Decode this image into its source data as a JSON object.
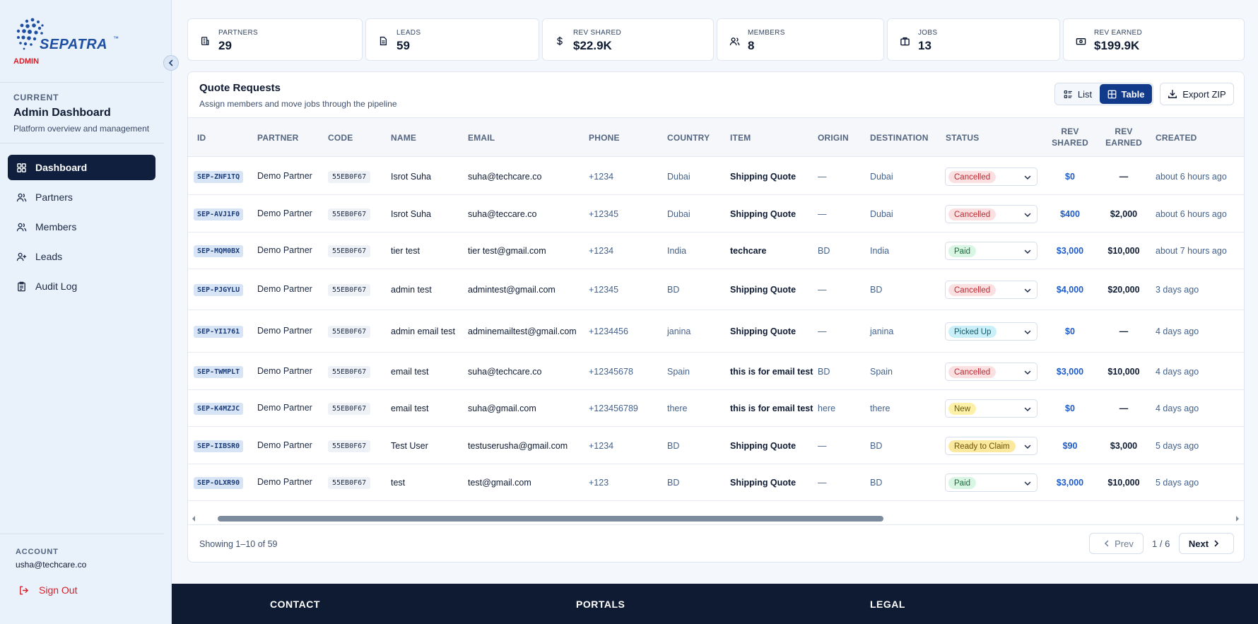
{
  "sidebar": {
    "logo_text": "SEPATRA",
    "logo_tm": "™",
    "role": "ADMIN",
    "current_label": "CURRENT",
    "current_title": "Admin Dashboard",
    "current_subtitle": "Platform overview and management",
    "nav": [
      {
        "label": "Dashboard",
        "icon": "grid-icon",
        "active": true
      },
      {
        "label": "Partners",
        "icon": "users-icon",
        "active": false
      },
      {
        "label": "Members",
        "icon": "users-icon",
        "active": false
      },
      {
        "label": "Leads",
        "icon": "user-plus-icon",
        "active": false
      },
      {
        "label": "Audit Log",
        "icon": "clipboard-icon",
        "active": false
      }
    ],
    "account_label": "ACCOUNT",
    "account_email": "usha@techcare.co",
    "sign_out": "Sign Out"
  },
  "stats": [
    {
      "label": "PARTNERS",
      "value": "29",
      "icon": "building-icon"
    },
    {
      "label": "LEADS",
      "value": "59",
      "icon": "document-icon"
    },
    {
      "label": "REV SHARED",
      "value": "$22.9K",
      "icon": "dollar-icon"
    },
    {
      "label": "MEMBERS",
      "value": "8",
      "icon": "members-icon"
    },
    {
      "label": "JOBS",
      "value": "13",
      "icon": "briefcase-icon"
    },
    {
      "label": "REV EARNED",
      "value": "$199.9K",
      "icon": "cash-icon"
    }
  ],
  "panel": {
    "title": "Quote Requests",
    "subtitle": "Assign members and move jobs through the pipeline",
    "list_label": "List",
    "table_label": "Table",
    "export_label": "Export ZIP"
  },
  "columns": {
    "id": "ID",
    "partner": "PARTNER",
    "code": "CODE",
    "name": "NAME",
    "email": "EMAIL",
    "phone": "PHONE",
    "country": "COUNTRY",
    "item": "ITEM",
    "origin": "ORIGIN",
    "destination": "DESTINATION",
    "status": "STATUS",
    "rev_shared_1": "REV",
    "rev_shared_2": "SHARED",
    "rev_earned_1": "REV",
    "rev_earned_2": "EARNED",
    "created": "CREATED"
  },
  "rows": [
    {
      "id": "SEP-ZNF1TQ",
      "partner": "Demo Partner",
      "code": "55EB0F67",
      "name": "Isrot Suha",
      "email": "suha@techcare.co",
      "phone": "+1234",
      "country": "Dubai",
      "item": "Shipping Quote",
      "origin": "—",
      "destination": "Dubai",
      "status": "Cancelled",
      "rev_shared": "$0",
      "rev_earned": "—",
      "created": "about 6 hours ago"
    },
    {
      "id": "SEP-AVJ1F0",
      "partner": "Demo Partner",
      "code": "55EB0F67",
      "name": "Isrot Suha",
      "email": "suha@teccare.co",
      "phone": "+12345",
      "country": "Dubai",
      "item": "Shipping Quote",
      "origin": "—",
      "destination": "Dubai",
      "status": "Cancelled",
      "rev_shared": "$400",
      "rev_earned": "$2,000",
      "created": "about 6 hours ago"
    },
    {
      "id": "SEP-MQM0BX",
      "partner": "Demo Partner",
      "code": "55EB0F67",
      "name": "tier test",
      "email": "tier test@gmail.com",
      "phone": "+1234",
      "country": "India",
      "item": "techcare",
      "origin": "BD",
      "destination": "India",
      "status": "Paid",
      "rev_shared": "$3,000",
      "rev_earned": "$10,000",
      "created": "about 7 hours ago"
    },
    {
      "id": "SEP-PJGYLU",
      "partner": "Demo Partner",
      "code": "55EB0F67",
      "name": "admin test",
      "email": "admintest@gmail.com",
      "phone": "+12345",
      "country": "BD",
      "item": "Shipping Quote",
      "origin": "—",
      "destination": "BD",
      "status": "Cancelled",
      "rev_shared": "$4,000",
      "rev_earned": "$20,000",
      "created": "3 days ago"
    },
    {
      "id": "SEP-YI1761",
      "partner": "Demo Partner",
      "code": "55EB0F67",
      "name": "admin email test",
      "email": "adminemailtest@gmail.com",
      "phone": "+1234456",
      "country": "janina",
      "item": "Shipping Quote",
      "origin": "—",
      "destination": "janina",
      "status": "Picked Up",
      "rev_shared": "$0",
      "rev_earned": "—",
      "created": "4 days ago"
    },
    {
      "id": "SEP-TWMPLT",
      "partner": "Demo Partner",
      "code": "55EB0F67",
      "name": "email test",
      "email": "suha@techcare.co",
      "phone": "+12345678",
      "country": "Spain",
      "item": "this is for email test",
      "origin": "BD",
      "destination": "Spain",
      "status": "Cancelled",
      "rev_shared": "$3,000",
      "rev_earned": "$10,000",
      "created": "4 days ago"
    },
    {
      "id": "SEP-K4MZJC",
      "partner": "Demo Partner",
      "code": "55EB0F67",
      "name": "email test",
      "email": "suha@gmail.com",
      "phone": "+123456789",
      "country": "there",
      "item": "this is for email test",
      "origin": "here",
      "destination": "there",
      "status": "New",
      "rev_shared": "$0",
      "rev_earned": "—",
      "created": "4 days ago"
    },
    {
      "id": "SEP-IIBSR0",
      "partner": "Demo Partner",
      "code": "55EB0F67",
      "name": "Test User",
      "email": "testuserusha@gmail.com",
      "phone": "+1234",
      "country": "BD",
      "item": "Shipping Quote",
      "origin": "—",
      "destination": "BD",
      "status": "Ready to Claim",
      "rev_shared": "$90",
      "rev_earned": "$3,000",
      "created": "5 days ago"
    },
    {
      "id": "SEP-OLXR90",
      "partner": "Demo Partner",
      "code": "55EB0F67",
      "name": "test",
      "email": "test@gmail.com",
      "phone": "+123",
      "country": "BD",
      "item": "Shipping Quote",
      "origin": "—",
      "destination": "BD",
      "status": "Paid",
      "rev_shared": "$3,000",
      "rev_earned": "$10,000",
      "created": "5 days ago"
    }
  ],
  "pagination": {
    "showing": "Showing 1–10 of 59",
    "prev": "Prev",
    "page": "1 / 6",
    "next": "Next"
  },
  "footer": {
    "contact": "CONTACT",
    "portals": "PORTALS",
    "legal": "LEGAL"
  }
}
